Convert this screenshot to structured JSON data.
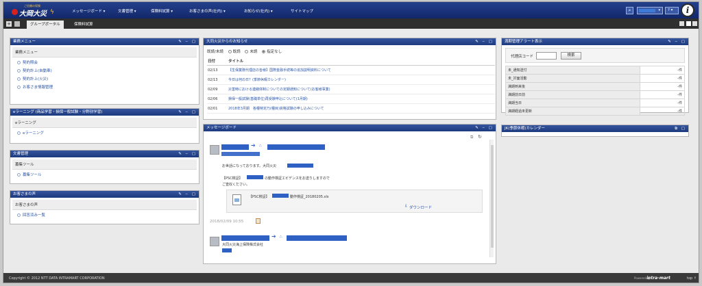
{
  "header": {
    "logo_sub": "ご信頼の保険",
    "logo_name": "大岡大災",
    "nav": [
      {
        "label": "メッセージボード ▾",
        "left": 0
      },
      {
        "label": "文書管理 ▾"
      },
      {
        "label": "保険料試算 ▾"
      },
      {
        "label": "お客さまの声(社内) ▾"
      },
      {
        "label": "お知らせ(社内) ▾"
      },
      {
        "label": "サイトマップ"
      }
    ],
    "help_label": "? ▾",
    "info_glyph": "i"
  },
  "tabs": {
    "active": "グループポータル",
    "inactive": "保険料試算"
  },
  "portlets": {
    "business_menu": {
      "title": "業務メニュー",
      "section": "業務メニュー",
      "links": [
        "契約照会",
        "契約計上(自動車)",
        "契約計上(火災)",
        "お客さま情報管理"
      ]
    },
    "elearning": {
      "title": "eラーニング (商品学習・損保一般試験・分野別学習)",
      "section": "eラーニング",
      "links": [
        "eラーニング"
      ]
    },
    "document": {
      "title": "文書管理",
      "section": "募集ツール",
      "links": [
        "募集ツール"
      ]
    },
    "voice": {
      "title": "お客さまの声",
      "section": "お客さまの声",
      "links": [
        "回答済み一覧"
      ]
    },
    "news": {
      "title": "大同火災からのお知らせ",
      "filter_label": "既読/未読",
      "filters": [
        "既読",
        "未読",
        "指定なし"
      ],
      "col_date": "日付",
      "col_title": "タイトル",
      "rows": [
        {
          "date": "02/13",
          "title": "【生保業務代理店の皆様】国際金融手続等の追加説明資料について"
        },
        {
          "date": "02/13",
          "title": "今日は何の日？(季節休暇カレンダー)"
        },
        {
          "date": "02/09",
          "title": "災害時における連絡体制についての定期通知について(お客様事業)"
        },
        {
          "date": "02/06",
          "title": "損保一般試験(基礎単位)再受験申込について(1月期)"
        },
        {
          "date": "02/01",
          "title": "2018年3月期　各種特定乃(種目)資格試験の申し込みについて"
        }
      ]
    },
    "message_board": {
      "title": "メッセージボード",
      "greeting": "お世話になっております。大同火災",
      "body_text": "の動作検証エビデンスをお送りしますので",
      "body_text2": "ご査収ください。",
      "attach_prefix": "【PSC検証】",
      "attach_name": "動作検証_20180205.xls",
      "download": "ダウンロード",
      "timestamp": "2018/02/09 10:55",
      "reply_dept": "大同火災海上保険株式会社"
    },
    "alert": {
      "title": "満期管理アラート表示",
      "code_label": "代理店コード",
      "search_button": "検索",
      "rows": [
        {
          "label": "未_通知送付",
          "value": "-件"
        },
        {
          "label": "未_対面活動",
          "value": "-件"
        },
        {
          "label": "満期到来後",
          "value": "-件"
        },
        {
          "label": "満期前日前",
          "value": "-件"
        },
        {
          "label": "満期当日",
          "value": "-件"
        },
        {
          "label": "満期経過未更新",
          "value": "-件"
        }
      ]
    },
    "calendar": {
      "title": "JK(季節休暇)カレンダー"
    }
  },
  "footer": {
    "copyright": "Copyright © 2012 NTT DATA INTRAMART CORPORATION",
    "powered": "Powered by",
    "brand": "intra-mart",
    "top": "top ↑"
  },
  "colors": {
    "nav_bg": "#1c3a7e",
    "link": "#2b55a8",
    "redaction": "#2f61c5"
  }
}
